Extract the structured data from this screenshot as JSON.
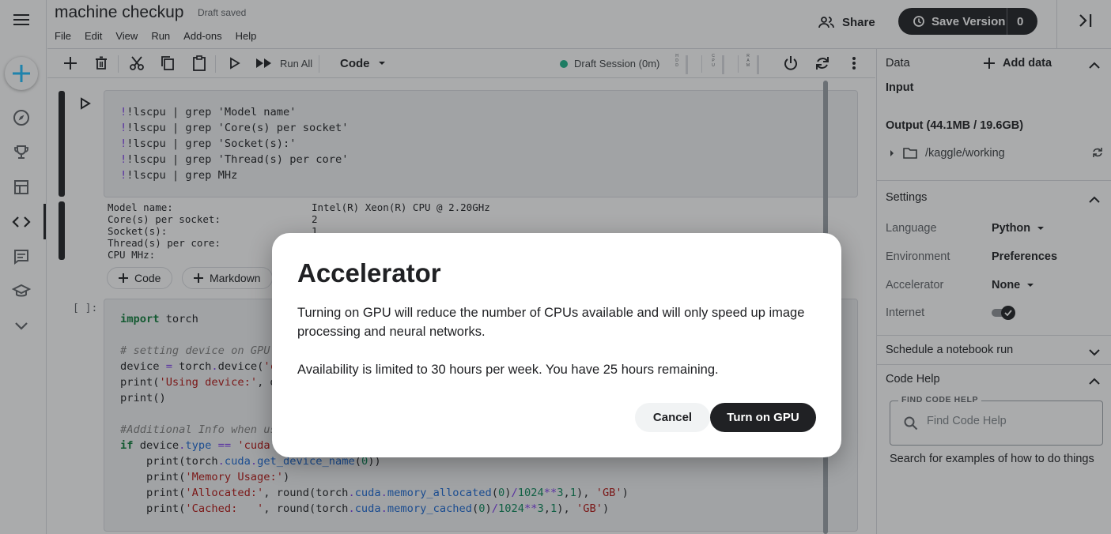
{
  "header": {
    "title": "machine checkup",
    "status": "Draft saved",
    "menu": [
      "File",
      "Edit",
      "View",
      "Run",
      "Add-ons",
      "Help"
    ],
    "share_label": "Share",
    "save_version_label": "Save Version",
    "save_version_count": "0"
  },
  "rail": {
    "icons": [
      "hamburger-icon",
      "create-icon",
      "compass-icon",
      "trophy-icon",
      "table-icon",
      "code-icon",
      "comments-icon",
      "school-icon",
      "chevron-down-icon"
    ]
  },
  "toolbar": {
    "run_all_label": "Run All",
    "cell_type": "Code",
    "session_label": "Draft Session (0m)",
    "meters": [
      "HDD",
      "CPU",
      "RAM"
    ]
  },
  "notebook": {
    "cell1_lines": [
      "!lscpu | grep 'Model name'",
      "!lscpu | grep 'Core(s) per socket'",
      "!lscpu | grep 'Socket(s):'",
      "!lscpu | grep 'Thread(s) per core'",
      "!lscpu | grep MHz"
    ],
    "output_keys": [
      "Model name:",
      "Core(s) per socket:",
      "Socket(s):",
      "Thread(s) per core:",
      "CPU MHz:"
    ],
    "output_values": [
      "Intel(R) Xeon(R) CPU @ 2.20GHz",
      "2",
      "1",
      "",
      ""
    ],
    "add_code_label": "Code",
    "add_markdown_label": "Markdown",
    "cell2_prompt": "[ ]:"
  },
  "panel": {
    "data_title": "Data",
    "add_data_label": "Add data",
    "input_label": "Input",
    "output_label": "Output (44.1MB / 19.6GB)",
    "working_path": "/kaggle/working",
    "settings_title": "Settings",
    "settings": [
      {
        "label": "Language",
        "value": "Python"
      },
      {
        "label": "Environment",
        "value": "Preferences"
      },
      {
        "label": "Accelerator",
        "value": "None"
      },
      {
        "label": "Internet",
        "value": ""
      }
    ],
    "internet_on": true,
    "schedule_label": "Schedule a notebook run",
    "code_help_title": "Code Help",
    "find_label": "FIND CODE HELP",
    "find_placeholder": "Find Code Help",
    "find_help_text": "Search for examples of how to do things"
  },
  "dialog": {
    "title": "Accelerator",
    "text1": "Turning on GPU will reduce the number of CPUs available and will only speed up image processing and neural networks.",
    "text2": "Availability is limited to 30 hours per week. You have 25 hours remaining.",
    "cancel_label": "Cancel",
    "confirm_label": "Turn on GPU"
  },
  "colors": {
    "accent": "#20beff",
    "dark": "#202124",
    "session_dot": "#1db48a"
  }
}
